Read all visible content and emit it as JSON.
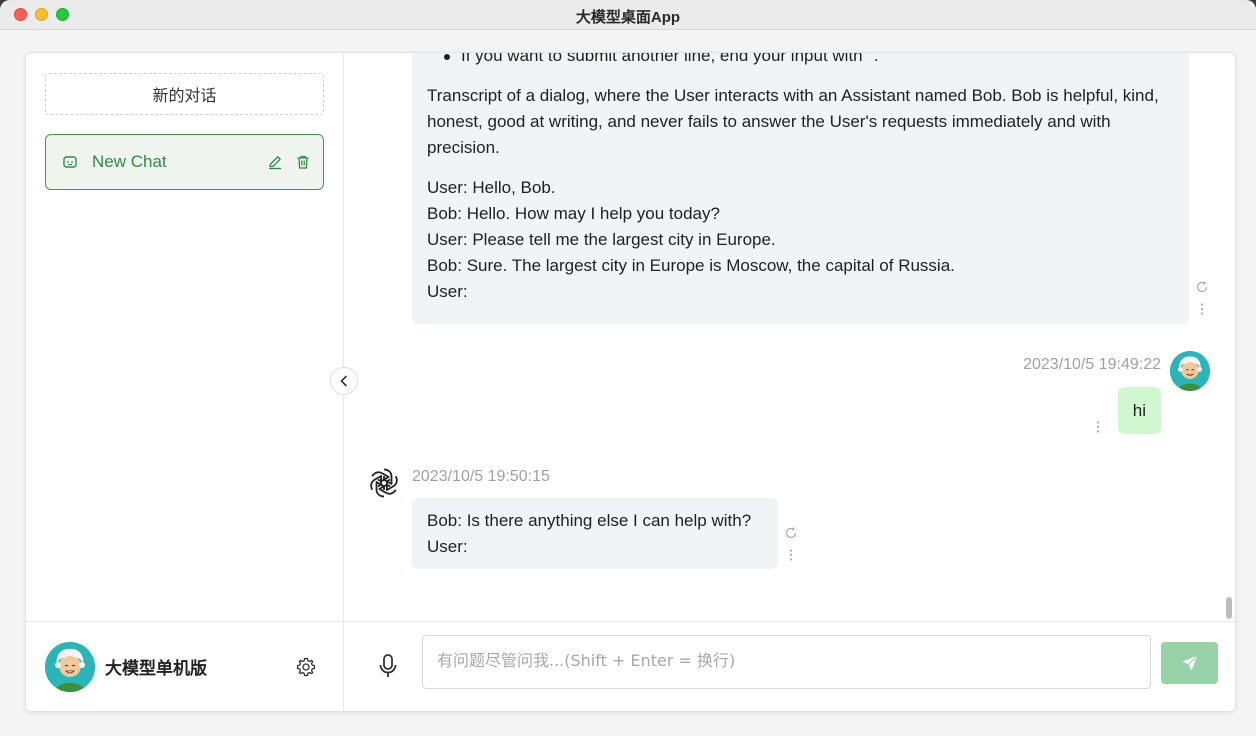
{
  "window": {
    "title": "大模型桌面App"
  },
  "sidebar": {
    "new_chat_label": "新的对话",
    "chats": [
      {
        "label": "New Chat",
        "active": true
      }
    ],
    "footer": {
      "user_name": "大模型单机版"
    }
  },
  "messages": [
    {
      "role": "assistant",
      "bullet": "If you want to submit another line, end your input with ''.",
      "paragraph": "Transcript of a dialog, where the User interacts with an Assistant named Bob. Bob is helpful, kind, honest, good at writing, and never fails to answer the User's requests immediately and with precision.",
      "lines": [
        "User: Hello, Bob.",
        "Bob: Hello. How may I help you today?",
        "User: Please tell me the largest city in Europe.",
        "Bob: Sure. The largest city in Europe is Moscow, the capital of Russia.",
        "User:"
      ]
    },
    {
      "role": "user",
      "timestamp": "2023/10/5 19:49:22",
      "text": "hi"
    },
    {
      "role": "assistant",
      "timestamp": "2023/10/5 19:50:15",
      "lines": [
        "Bob: Is there anything else I can help with?",
        "User:"
      ]
    }
  ],
  "composer": {
    "placeholder": "有问题尽管问我...(Shift + Enter = 换行)"
  },
  "colors": {
    "accent_green": "#3d9c52",
    "user_bubble": "#d2f8d2",
    "bot_bubble": "#f1f4f7",
    "send_button": "#98d2a8"
  },
  "icons": {
    "chat_item": "robot-icon",
    "edit": "pencil-icon",
    "delete": "trash-icon",
    "settings": "gear-icon",
    "collapse": "chevron-left-icon",
    "regenerate": "refresh-icon",
    "more": "more-vertical-icon",
    "assistant": "openai-logo-icon",
    "mic": "microphone-icon",
    "send": "send-icon"
  }
}
